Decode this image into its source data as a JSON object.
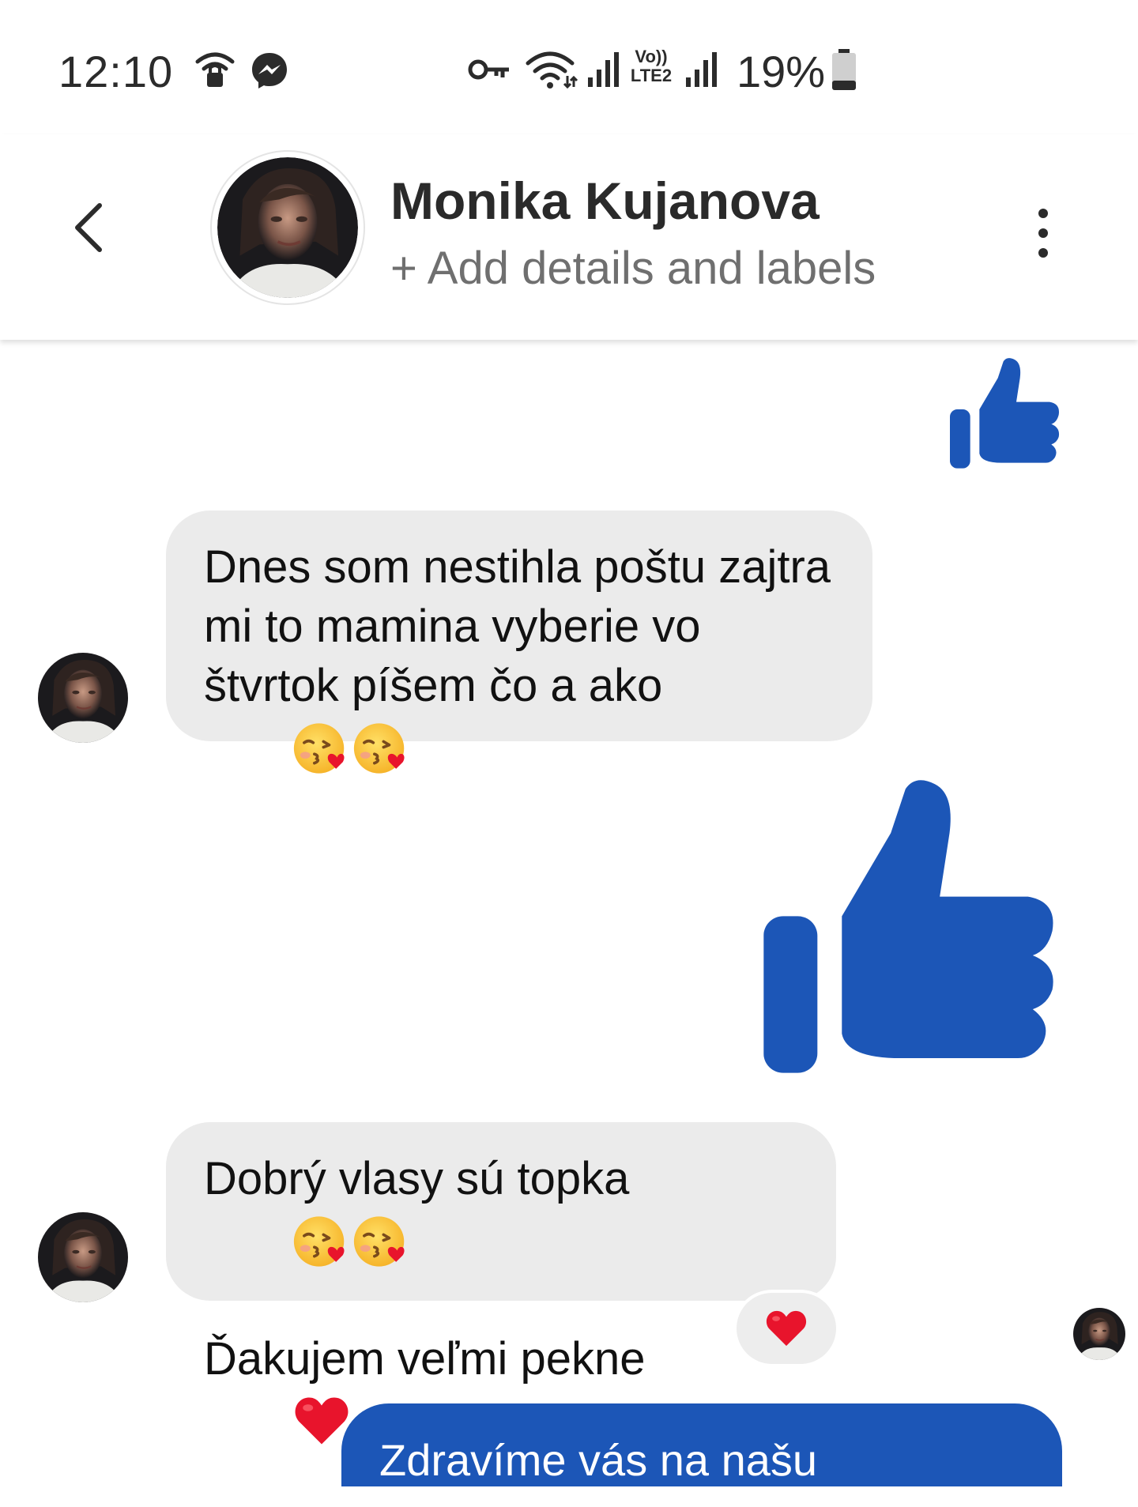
{
  "status_bar": {
    "time": "12:10",
    "volte_label_top": "Vo))",
    "volte_label_bottom": "LTE2",
    "battery": "19%",
    "icons": [
      "wifi-lock-icon",
      "messenger-icon",
      "vpn-key-icon",
      "wifi-icon",
      "signal-icon",
      "signal-icon",
      "battery-icon"
    ]
  },
  "header": {
    "contact_name": "Monika Kujanova",
    "subtitle": "+ Add details and labels",
    "back_icon": "chevron-left-icon",
    "more_icon": "more-vertical-icon"
  },
  "colors": {
    "brand_blue": "#1c56b7",
    "incoming_bubble": "#ebebeb",
    "heart_red": "#e8142c"
  },
  "messages": [
    {
      "type": "like",
      "direction": "outgoing",
      "size": "small"
    },
    {
      "type": "text",
      "direction": "incoming",
      "lines": [
        "Dnes som nestihla poštu zajtra",
        "mi to mamina vyberie vo",
        "štvrtok píšem čo a ako"
      ],
      "emojis": [
        "kissing-heart-emoji",
        "kissing-heart-emoji"
      ]
    },
    {
      "type": "like",
      "direction": "outgoing",
      "size": "large"
    },
    {
      "type": "text",
      "direction": "incoming",
      "lines": [
        "Dobrý vlasy sú topka",
        "Ďakujem veľmi pekne"
      ],
      "emojis_line1": [
        "kissing-heart-emoji",
        "kissing-heart-emoji"
      ],
      "emojis_line2": [
        "red-heart-emoji"
      ],
      "reaction": "red-heart-emoji"
    },
    {
      "type": "text",
      "direction": "outgoing",
      "text": "Zdravíme vás na našu"
    }
  ]
}
